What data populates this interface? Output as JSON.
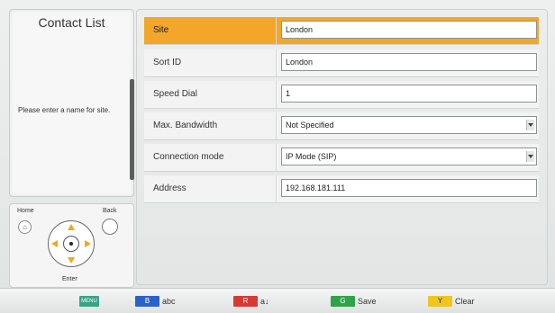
{
  "sidebar": {
    "title": "Contact List",
    "help_text": "Please enter a name for site."
  },
  "remote": {
    "home_label": "Home",
    "back_label": "Back",
    "enter_label": "Enter"
  },
  "form": {
    "rows": [
      {
        "label": "Site",
        "value": "London"
      },
      {
        "label": "Sort ID",
        "value": "London"
      },
      {
        "label": "Speed Dial",
        "value": "1"
      },
      {
        "label": "Max. Bandwidth",
        "value": "Not Specified"
      },
      {
        "label": "Connection mode",
        "value": "IP Mode (SIP)"
      },
      {
        "label": "Address",
        "value": "192.168.181.111"
      }
    ]
  },
  "bottom_bar": {
    "menu_key": "MENU",
    "blue": {
      "key": "B",
      "label": "abc",
      "color": "#2a63c7"
    },
    "red": {
      "key": "R",
      "label": "a↓",
      "color": "#d63a33"
    },
    "green": {
      "key": "G",
      "label": "Save",
      "color": "#2fa34c"
    },
    "yellow": {
      "key": "Y",
      "label": "Clear",
      "color": "#f0c51d"
    }
  },
  "colors": {
    "selected_row": "#f3a72a"
  }
}
